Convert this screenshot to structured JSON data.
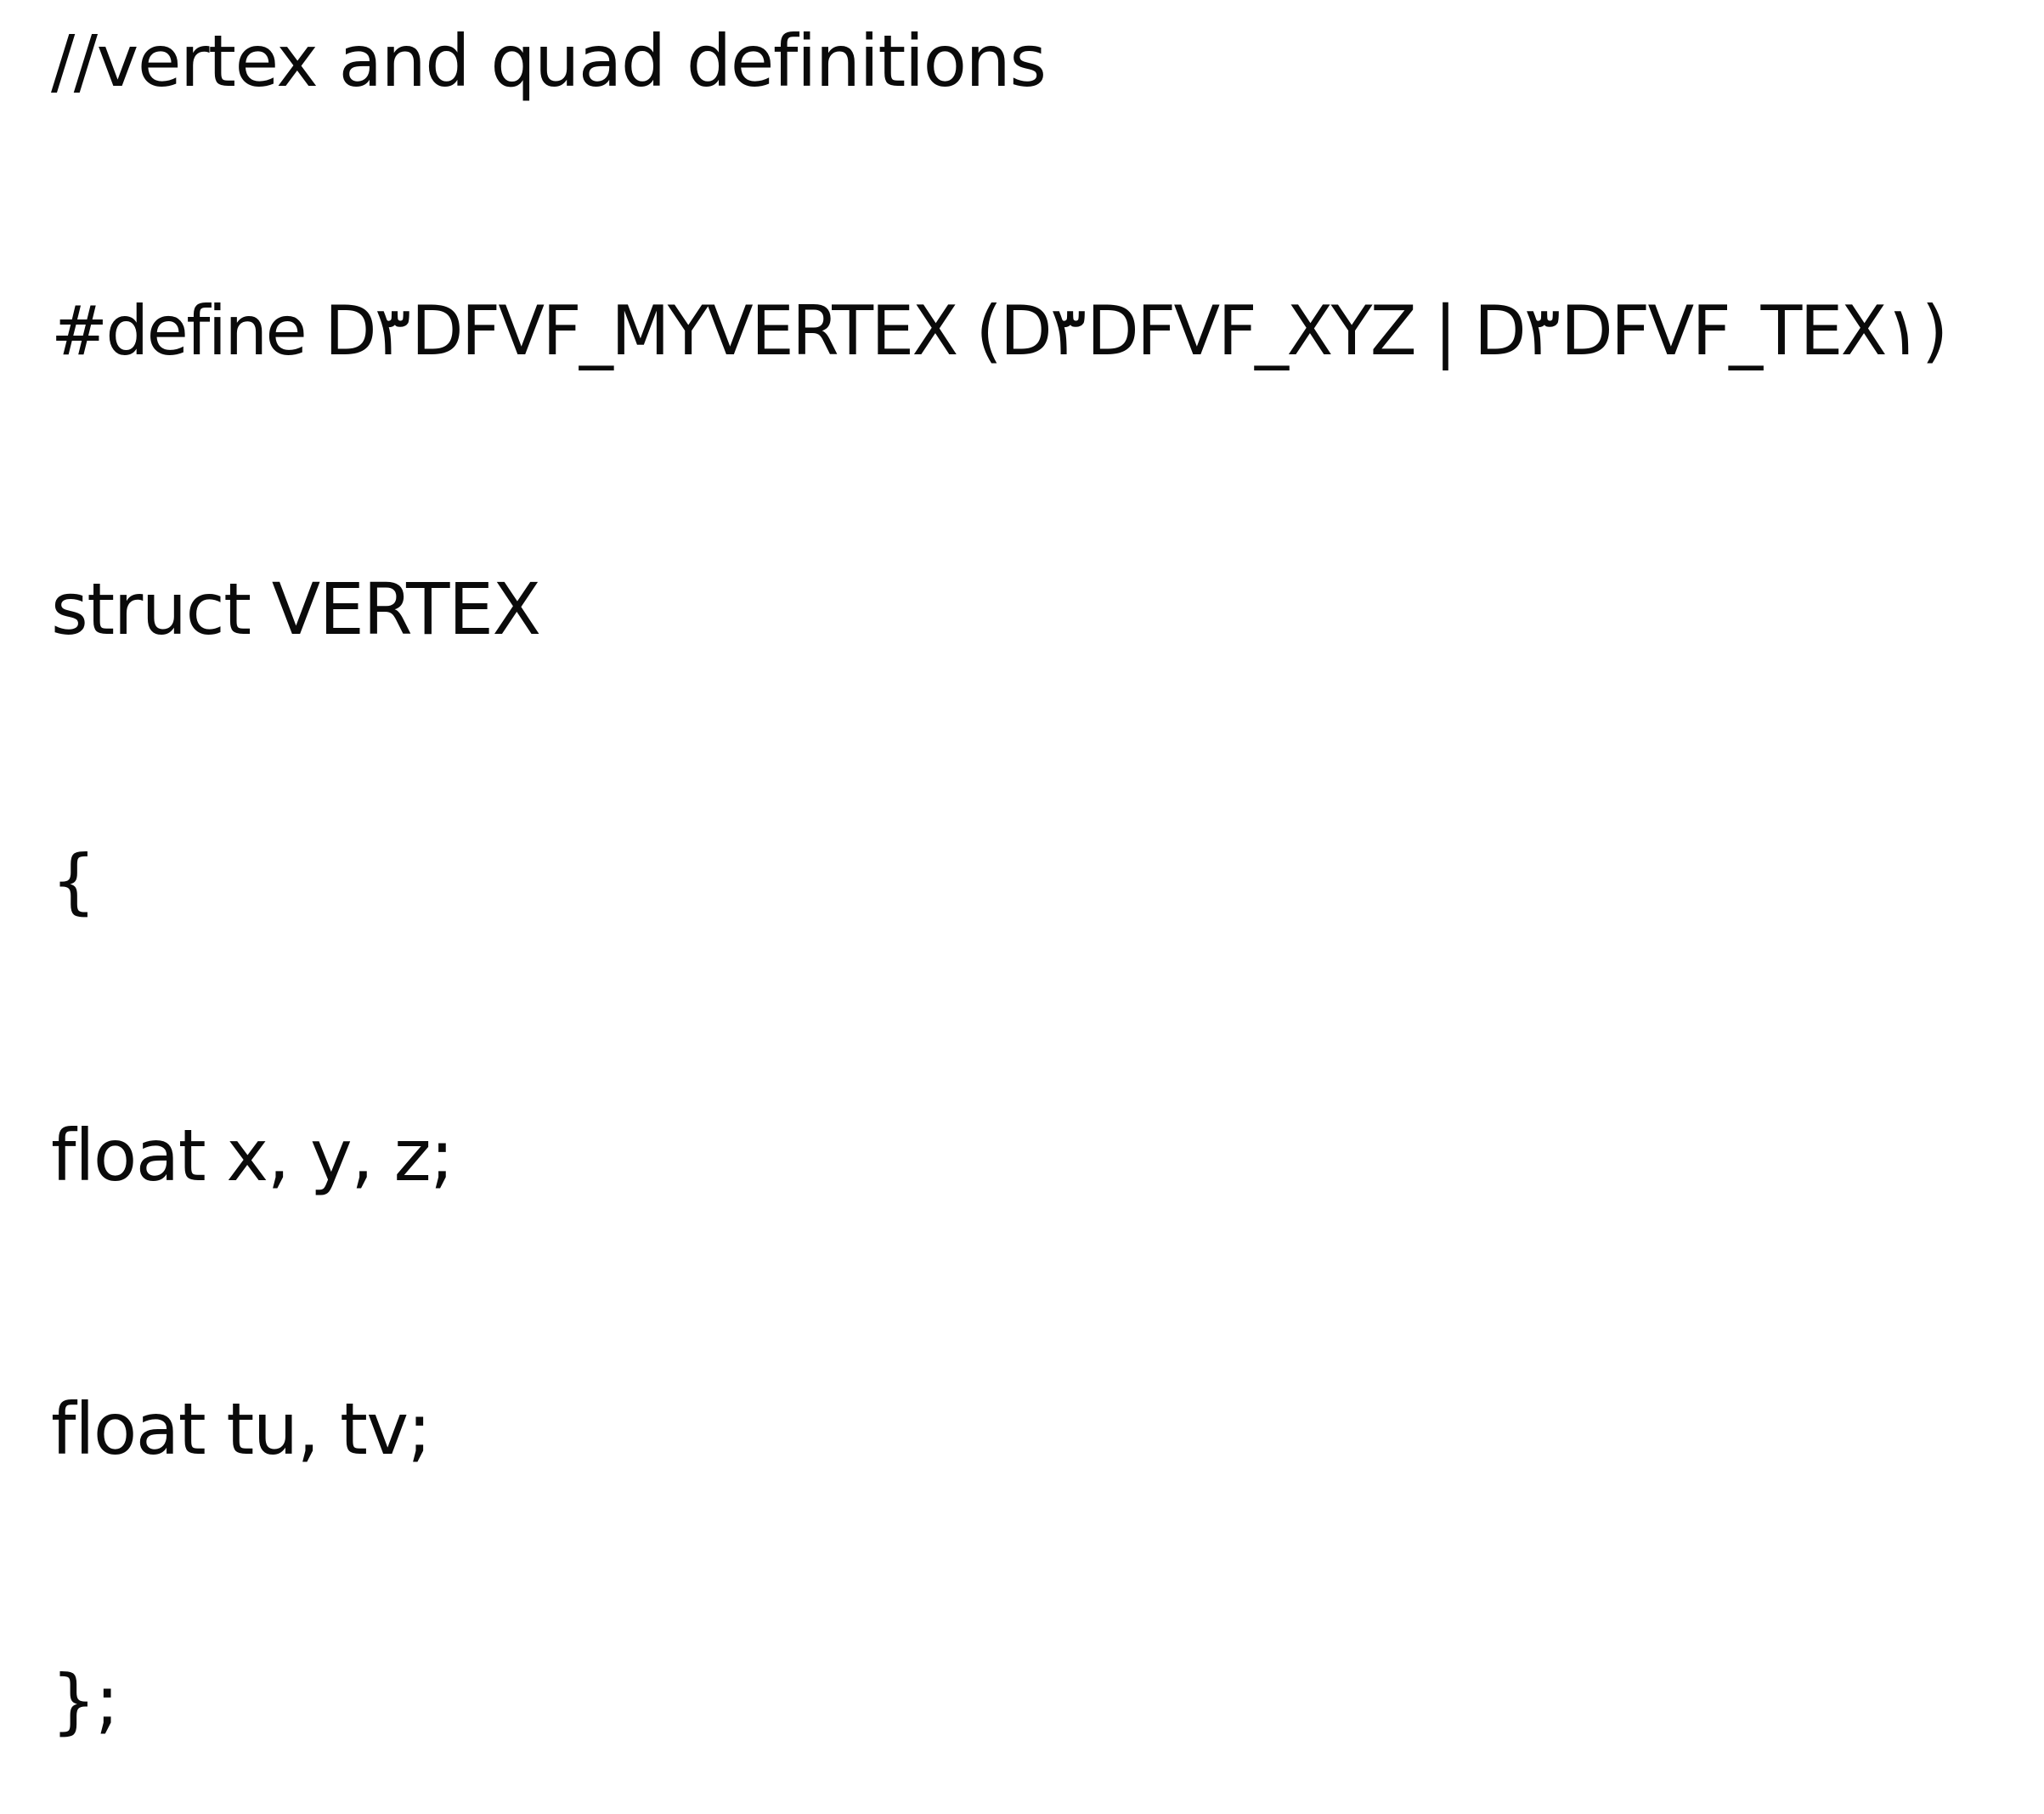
{
  "document": {
    "lines": [
      "//vertex and quad definitions",
      "#define D٣DFVF_MYVERTEX (D٣DFVF_XYZ | D٣DFVF_TEX١)",
      "struct VERTEX",
      "{",
      "float x, y, z;",
      "float tu, tv;",
      "};"
    ]
  }
}
